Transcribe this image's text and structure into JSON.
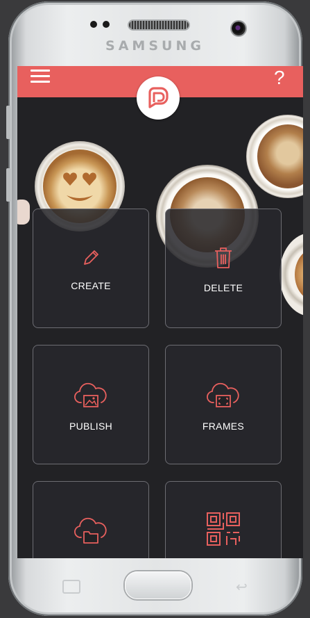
{
  "device": {
    "brand": "SAMSUNG"
  },
  "topbar": {
    "help_label": "?"
  },
  "tiles": [
    {
      "label": "CREATE",
      "icon": "pencil-icon"
    },
    {
      "label": "DELETE",
      "icon": "trash-icon"
    },
    {
      "label": "PUBLISH",
      "icon": "cloud-image-icon"
    },
    {
      "label": "FRAMES",
      "icon": "cloud-frame-icon"
    },
    {
      "label": "",
      "icon": "cloud-folder-icon"
    },
    {
      "label": "",
      "icon": "qr-code-icon"
    }
  ],
  "colors": {
    "accent": "#e8605e",
    "background": "#222225",
    "tile_border": "#6d6d73"
  }
}
